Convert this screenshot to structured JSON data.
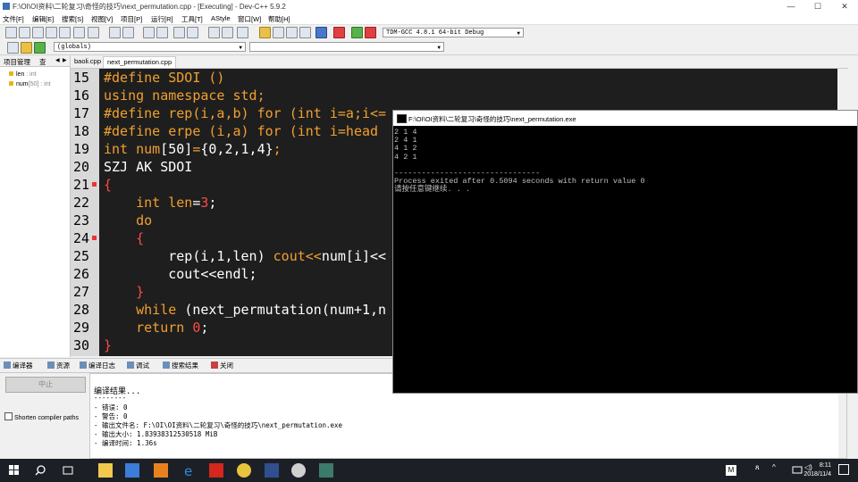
{
  "window": {
    "title": "F:\\OI\\OI资料\\二轮复习\\奇怪的技巧\\next_permutation.cpp - [Executing] - Dev-C++ 5.9.2",
    "minimize": "—",
    "maximize": "☐",
    "close": "✕"
  },
  "menu": [
    "文件[F]",
    "编辑[E]",
    "搜索[S]",
    "视图[V]",
    "项目[P]",
    "运行[R]",
    "工具[T]",
    "AStyle",
    "窗口[W]",
    "帮助[H]"
  ],
  "toolbar": {
    "compiler_select": "TDM-GCC 4.8.1 64-bit Debug",
    "scope_select": "(globals)"
  },
  "left_panel": {
    "tabs": [
      "项目管理",
      "查"
    ],
    "items": [
      {
        "name": "len",
        "type": ": int"
      },
      {
        "name": "num",
        "type": "[50] : int"
      }
    ]
  },
  "editor": {
    "tabs": [
      "baoli.cpp",
      "next_permutation.cpp"
    ],
    "line_numbers": [
      "15",
      "16",
      "17",
      "18",
      "19",
      "20",
      "21",
      "22",
      "23",
      "24",
      "25",
      "26",
      "27",
      "28",
      "29",
      "30"
    ],
    "code_lines": [
      [
        {
          "t": "#define SDOI ()",
          "c": "or"
        }
      ],
      [
        {
          "t": "using namespace std;",
          "c": "or"
        }
      ],
      [
        {
          "t": "#define rep(i,a,b) for (int i=a;i<=",
          "c": "or"
        }
      ],
      [
        {
          "t": "#define erpe (i,a) for (int i=head",
          "c": "or"
        }
      ],
      [
        {
          "t": "int num",
          "c": "or"
        },
        {
          "t": "[50]",
          "c": "wh"
        },
        {
          "t": "=",
          "c": "or"
        },
        {
          "t": "{0,2,1,4}",
          "c": "wh"
        },
        {
          "t": ";",
          "c": "or"
        }
      ],
      [
        {
          "t": "SZJ AK SDOI",
          "c": "wh"
        }
      ],
      [
        {
          "t": "{",
          "c": "red"
        }
      ],
      [
        {
          "t": "    int len",
          "c": "or"
        },
        {
          "t": "=",
          "c": "wh"
        },
        {
          "t": "3",
          "c": "red"
        },
        {
          "t": ";",
          "c": "wh"
        }
      ],
      [
        {
          "t": "    do",
          "c": "or"
        }
      ],
      [
        {
          "t": "    {",
          "c": "red"
        }
      ],
      [
        {
          "t": "        rep(i,1,len) ",
          "c": "wh"
        },
        {
          "t": "cout<<",
          "c": "or"
        },
        {
          "t": "num[i]<<",
          "c": "wh"
        }
      ],
      [
        {
          "t": "        cout<<endl;",
          "c": "wh"
        }
      ],
      [
        {
          "t": "    }",
          "c": "red"
        }
      ],
      [
        {
          "t": "    while ",
          "c": "or"
        },
        {
          "t": "(next_permutation(num+1,n",
          "c": "wh"
        }
      ],
      [
        {
          "t": "    return ",
          "c": "or"
        },
        {
          "t": "0",
          "c": "red"
        },
        {
          "t": ";",
          "c": "wh"
        }
      ],
      [
        {
          "t": "}",
          "c": "red"
        }
      ]
    ]
  },
  "console": {
    "title": "F:\\OI\\OI资料\\二轮复习\\奇怪的技巧\\next_permutation.exe",
    "lines": [
      "2 1 4",
      "2 4 1",
      "4 1 2",
      "4 2 1",
      "",
      "--------------------------------",
      "Process exited after 0.5094 seconds with return value 0",
      "请按任意键继续. . ."
    ]
  },
  "bottom": {
    "tabs": [
      "编译器",
      "资源",
      "编译日志",
      "调试",
      "搜索结果",
      "关闭"
    ],
    "stop_button": "中止",
    "shorten_label": "Shorten compiler paths",
    "output_lines": [
      "编译结果...",
      "--------",
      "- 错误: 0",
      "- 警告: 0",
      "- 输出文件名: F:\\OI\\OI资料\\二轮复习\\奇怪的技巧\\next_permutation.exe",
      "- 输出大小: 1.83938312530518 MiB",
      "- 编译时间: 1.36s"
    ]
  },
  "taskbar": {
    "time": "8:11",
    "date": "2018/11/4",
    "ime": "M"
  }
}
